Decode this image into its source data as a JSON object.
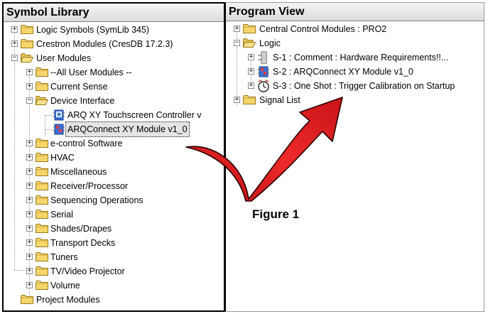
{
  "symbol_library": {
    "title": "Symbol Library",
    "items": [
      {
        "label": "Logic Symbols (SymLib 345)"
      },
      {
        "label": "Crestron Modules (CresDB 17.2.3)"
      },
      {
        "label": "User Modules"
      },
      {
        "label": "--All User Modules --"
      },
      {
        "label": "Current Sense"
      },
      {
        "label": "Device Interface"
      },
      {
        "label": "ARQ XY Touchscreen Controller v"
      },
      {
        "label": "ARQConnect XY Module v1_0"
      },
      {
        "label": "e-control Software"
      },
      {
        "label": "HVAC"
      },
      {
        "label": "Miscellaneous"
      },
      {
        "label": "Receiver/Processor"
      },
      {
        "label": "Sequencing Operations"
      },
      {
        "label": "Serial"
      },
      {
        "label": "Shades/Drapes"
      },
      {
        "label": "Transport Decks"
      },
      {
        "label": "Tuners"
      },
      {
        "label": "TV/Video Projector"
      },
      {
        "label": "Volume"
      },
      {
        "label": "Project Modules"
      }
    ]
  },
  "program_view": {
    "title": "Program View",
    "items": [
      {
        "label": "Central Control Modules : PRO2"
      },
      {
        "label": "Logic"
      },
      {
        "label": "S-1 : Comment : Hardware Requirements!!..."
      },
      {
        "label": "S-2 : ARQConnect XY Module v1_0"
      },
      {
        "label": "S-3 : One Shot : Trigger Calibration on Startup"
      },
      {
        "label": "Signal List"
      }
    ]
  },
  "figure": {
    "label": "Figure 1"
  },
  "colors": {
    "folder": "#f5d66b",
    "arrow": "#e0181c",
    "selection": "#e4e4e4"
  },
  "icons": {
    "folder": "folder-icon",
    "open_folder": "folder-open-icon",
    "module": "module-icon",
    "comment": "comment-icon",
    "one_shot": "one-shot-icon",
    "arrow": "curved-arrow-icon"
  }
}
